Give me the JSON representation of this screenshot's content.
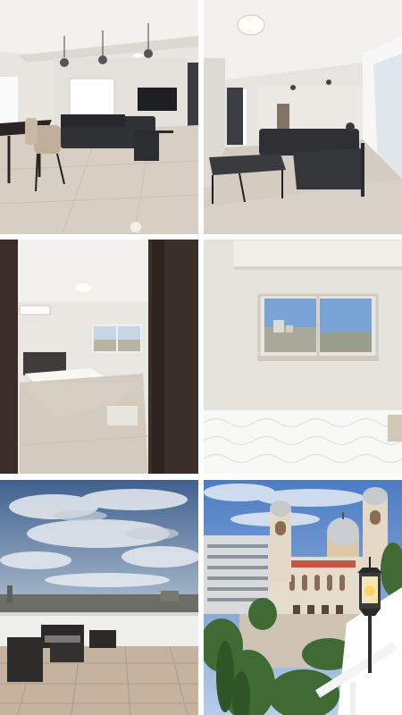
{
  "gallery": {
    "photos": [
      {
        "scene": "living-dining-room"
      },
      {
        "scene": "living-room-sofa"
      },
      {
        "scene": "bedroom"
      },
      {
        "scene": "bedroom-window"
      },
      {
        "scene": "rooftop-terrace"
      },
      {
        "scene": "church-view-balcony"
      }
    ]
  },
  "palette": {
    "wall": "#e9e6e1",
    "floor": "#d8cfc4",
    "sofa": "#2f3134",
    "sky": "#5f86b8",
    "wood": "#3b2f2a"
  }
}
